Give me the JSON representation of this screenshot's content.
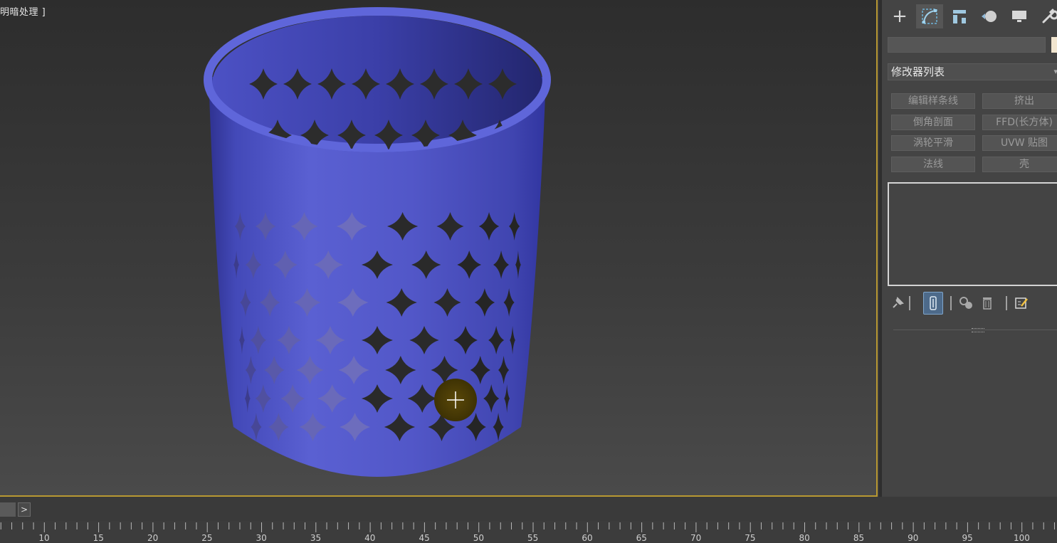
{
  "viewport": {
    "label": "明暗处理 ]",
    "object_color": "#5a5fd0",
    "frame_color": "#b89832"
  },
  "command_panel": {
    "tabs": [
      {
        "name": "create-tab",
        "icon": "plus-icon"
      },
      {
        "name": "modify-tab",
        "icon": "modify-curve-icon"
      },
      {
        "name": "hierarchy-tab",
        "icon": "hierarchy-icon"
      },
      {
        "name": "motion-tab",
        "icon": "motion-icon"
      },
      {
        "name": "display-tab",
        "icon": "display-monitor-icon"
      },
      {
        "name": "utilities-tab",
        "icon": "wrench-icon"
      }
    ],
    "active_tab": "modify-tab",
    "modifier_list_label": "修改器列表",
    "modifier_buttons": [
      "编辑样条线",
      "挤出",
      "倒角剖面",
      "FFD(长方体)",
      "涡轮平滑",
      "UVW 贴图",
      "法线",
      "壳"
    ],
    "stack_tools": [
      "pin-stack-icon",
      "show-end-result-icon",
      "make-unique-icon",
      "remove-modifier-icon",
      "configure-modifier-sets-icon"
    ],
    "swatch_color": "#f1e5cf"
  },
  "timeline": {
    "next_label": ">",
    "tick_labels": [
      "10",
      "15",
      "20",
      "25",
      "30",
      "35",
      "40",
      "45",
      "50",
      "55",
      "60",
      "65",
      "70",
      "75",
      "80",
      "85",
      "90",
      "95",
      "100"
    ]
  }
}
